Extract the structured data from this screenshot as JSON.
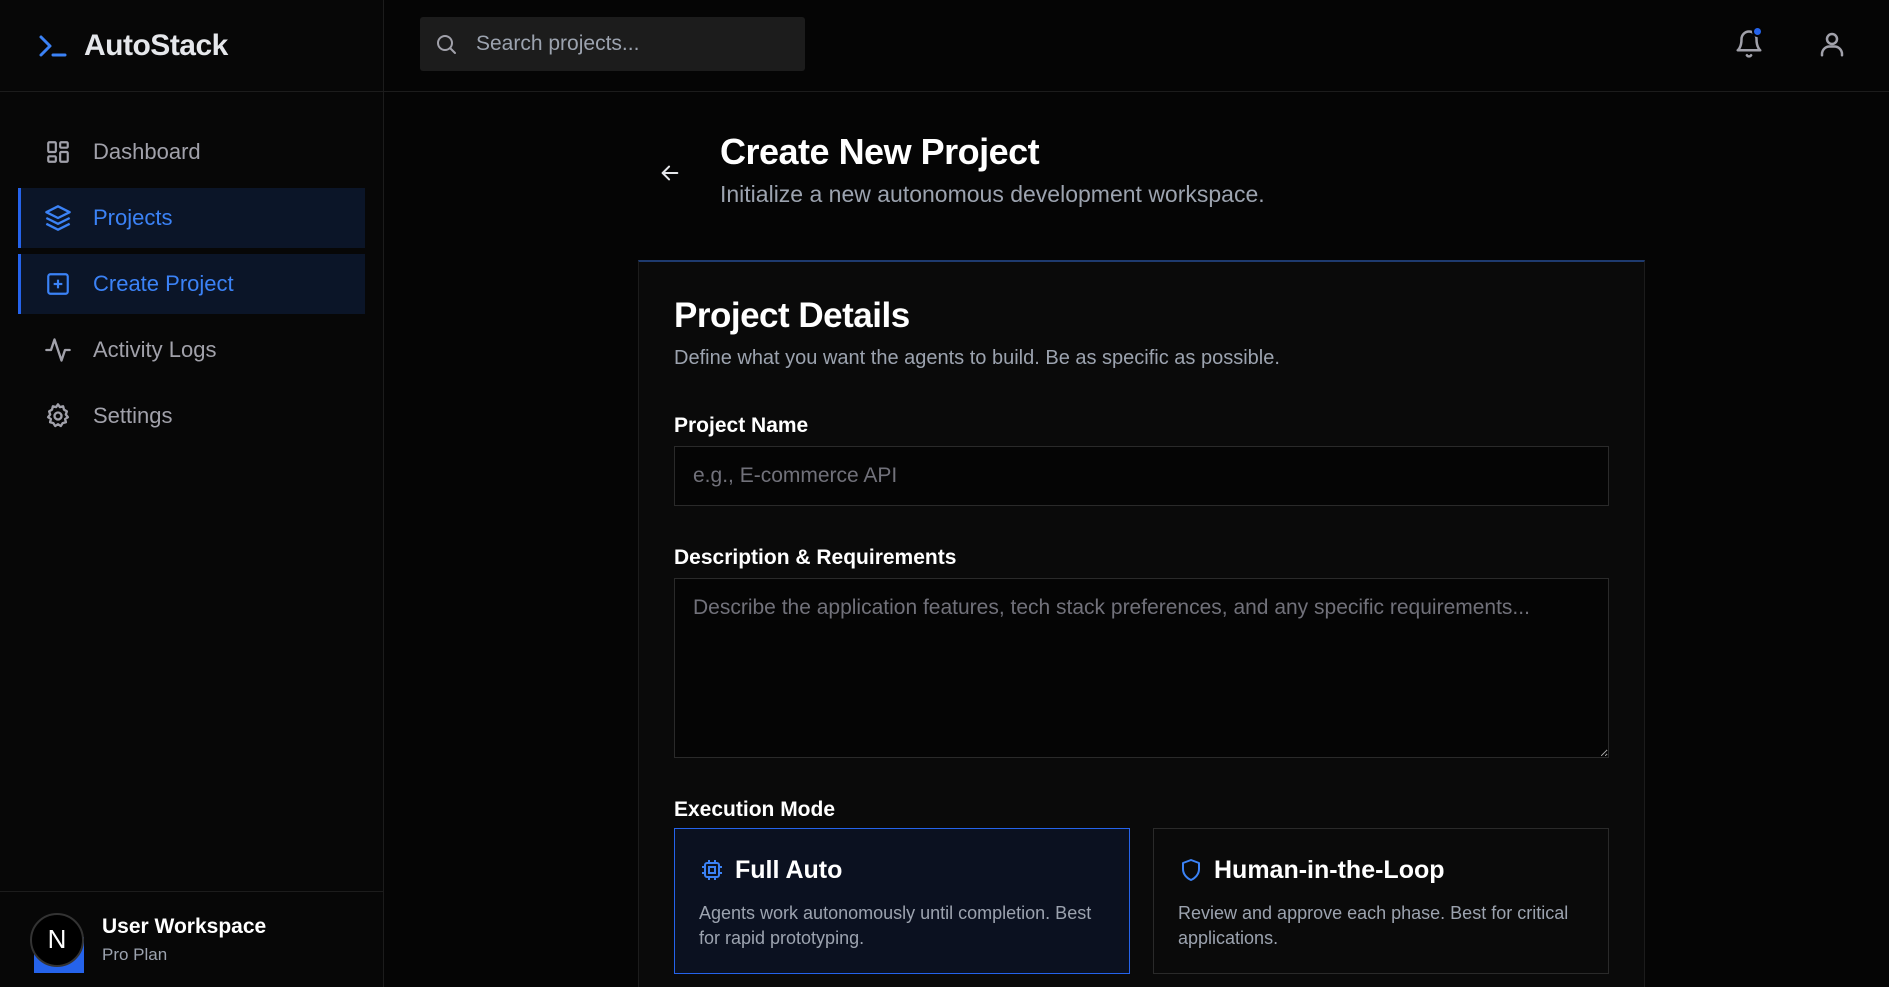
{
  "brand": {
    "name": "AutoStack"
  },
  "sidebar": {
    "items": [
      {
        "label": "Dashboard",
        "icon": "grid-icon",
        "active": false
      },
      {
        "label": "Projects",
        "icon": "layers-icon",
        "active": true
      },
      {
        "label": "Create Project",
        "icon": "plus-square-icon",
        "active": true
      },
      {
        "label": "Activity Logs",
        "icon": "activity-icon",
        "active": false
      },
      {
        "label": "Settings",
        "icon": "gear-icon",
        "active": false
      }
    ],
    "footer": {
      "avatar_letter": "N",
      "name": "User Workspace",
      "plan": "Pro Plan"
    }
  },
  "topbar": {
    "search_placeholder": "Search projects...",
    "notifications_unread": true
  },
  "page": {
    "title": "Create New Project",
    "subtitle": "Initialize a new autonomous development workspace."
  },
  "form": {
    "title": "Project Details",
    "description": "Define what you want the agents to build. Be as specific as possible.",
    "name_label": "Project Name",
    "name_placeholder": "e.g., E-commerce API",
    "name_value": "",
    "desc_label": "Description & Requirements",
    "desc_placeholder": "Describe the application features, tech stack preferences, and any specific requirements...",
    "desc_value": "",
    "mode_label": "Execution Mode",
    "modes": [
      {
        "title": "Full Auto",
        "desc": "Agents work autonomously until completion. Best for rapid prototyping.",
        "icon": "cpu-icon",
        "selected": true
      },
      {
        "title": "Human-in-the-Loop",
        "desc": "Review and approve each phase. Best for critical applications.",
        "icon": "shield-icon",
        "selected": false
      }
    ]
  },
  "colors": {
    "accent": "#2563eb",
    "accent_text": "#3b82f6",
    "background": "#050505",
    "muted": "#9ca3af"
  }
}
